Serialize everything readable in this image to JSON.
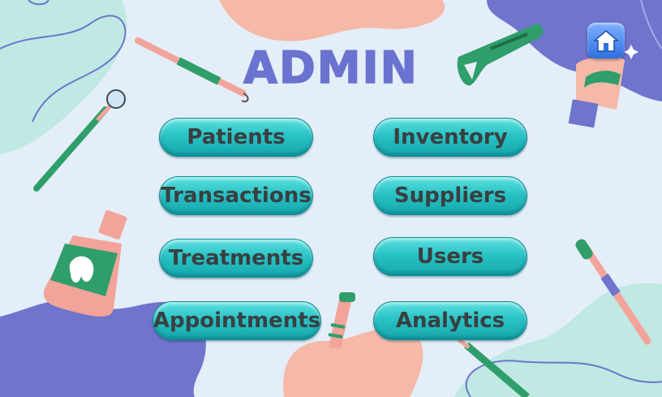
{
  "header": {
    "title": "ADMIN"
  },
  "nav": {
    "home_icon": "home-icon"
  },
  "menu": {
    "patients": "Patients",
    "inventory": "Inventory",
    "transactions": "Transactions",
    "suppliers": "Suppliers",
    "treatments": "Treatments",
    "users": "Users",
    "appointments": "Appointments",
    "analytics": "Analytics"
  },
  "colors": {
    "background": "#e4eef9",
    "title": "#6a73cf",
    "button": "#29c3c6",
    "button_text": "#3a3f40",
    "blob_purple": "#6f74cc",
    "blob_peach": "#f6b9a7",
    "blob_mint": "#bfe9e2"
  }
}
